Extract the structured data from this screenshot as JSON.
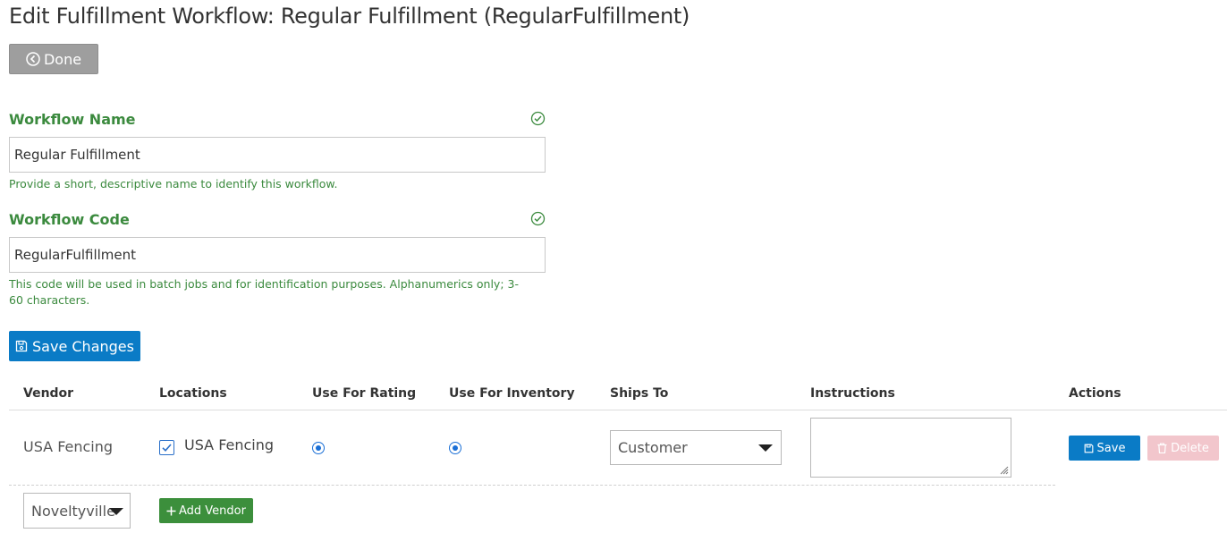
{
  "page": {
    "title": "Edit Fulfillment Workflow: Regular Fulfillment (RegularFulfillment)"
  },
  "toolbar": {
    "done_label": "Done"
  },
  "form": {
    "name_field": {
      "label": "Workflow Name",
      "value": "Regular Fulfillment",
      "help": "Provide a short, descriptive name to identify this workflow.",
      "valid": true
    },
    "code_field": {
      "label": "Workflow Code",
      "value": "RegularFulfillment",
      "help": "This code will be used in batch jobs and for identification purposes. Alphanumerics only; 3-60 characters.",
      "valid": true
    },
    "save_label": "Save Changes"
  },
  "table": {
    "headers": [
      "Vendor",
      "Locations",
      "Use For Rating",
      "Use For Inventory",
      "Ships To",
      "Instructions",
      "Actions"
    ],
    "rows": [
      {
        "vendor": "USA Fencing",
        "location": "USA Fencing",
        "location_checked": true,
        "use_for_rating": true,
        "use_for_inventory": true,
        "ships_to": "Customer",
        "instructions": "",
        "save_label": "Save",
        "delete_label": "Delete"
      }
    ],
    "add_row": {
      "vendor_select": "Noveltyville",
      "add_label": "Add Vendor"
    }
  },
  "colors": {
    "accent_blue": "#0a7bc6",
    "success_green": "#3b8a3e",
    "done_gray": "#9e9e9e",
    "delete_disabled": "#f2c6cc"
  },
  "icons": {
    "done": "circle-chevron-left-icon",
    "valid": "circle-check-icon",
    "save": "floppy-disk-icon",
    "delete": "trash-icon",
    "add": "plus-icon",
    "dropdown": "caret-down-icon"
  }
}
